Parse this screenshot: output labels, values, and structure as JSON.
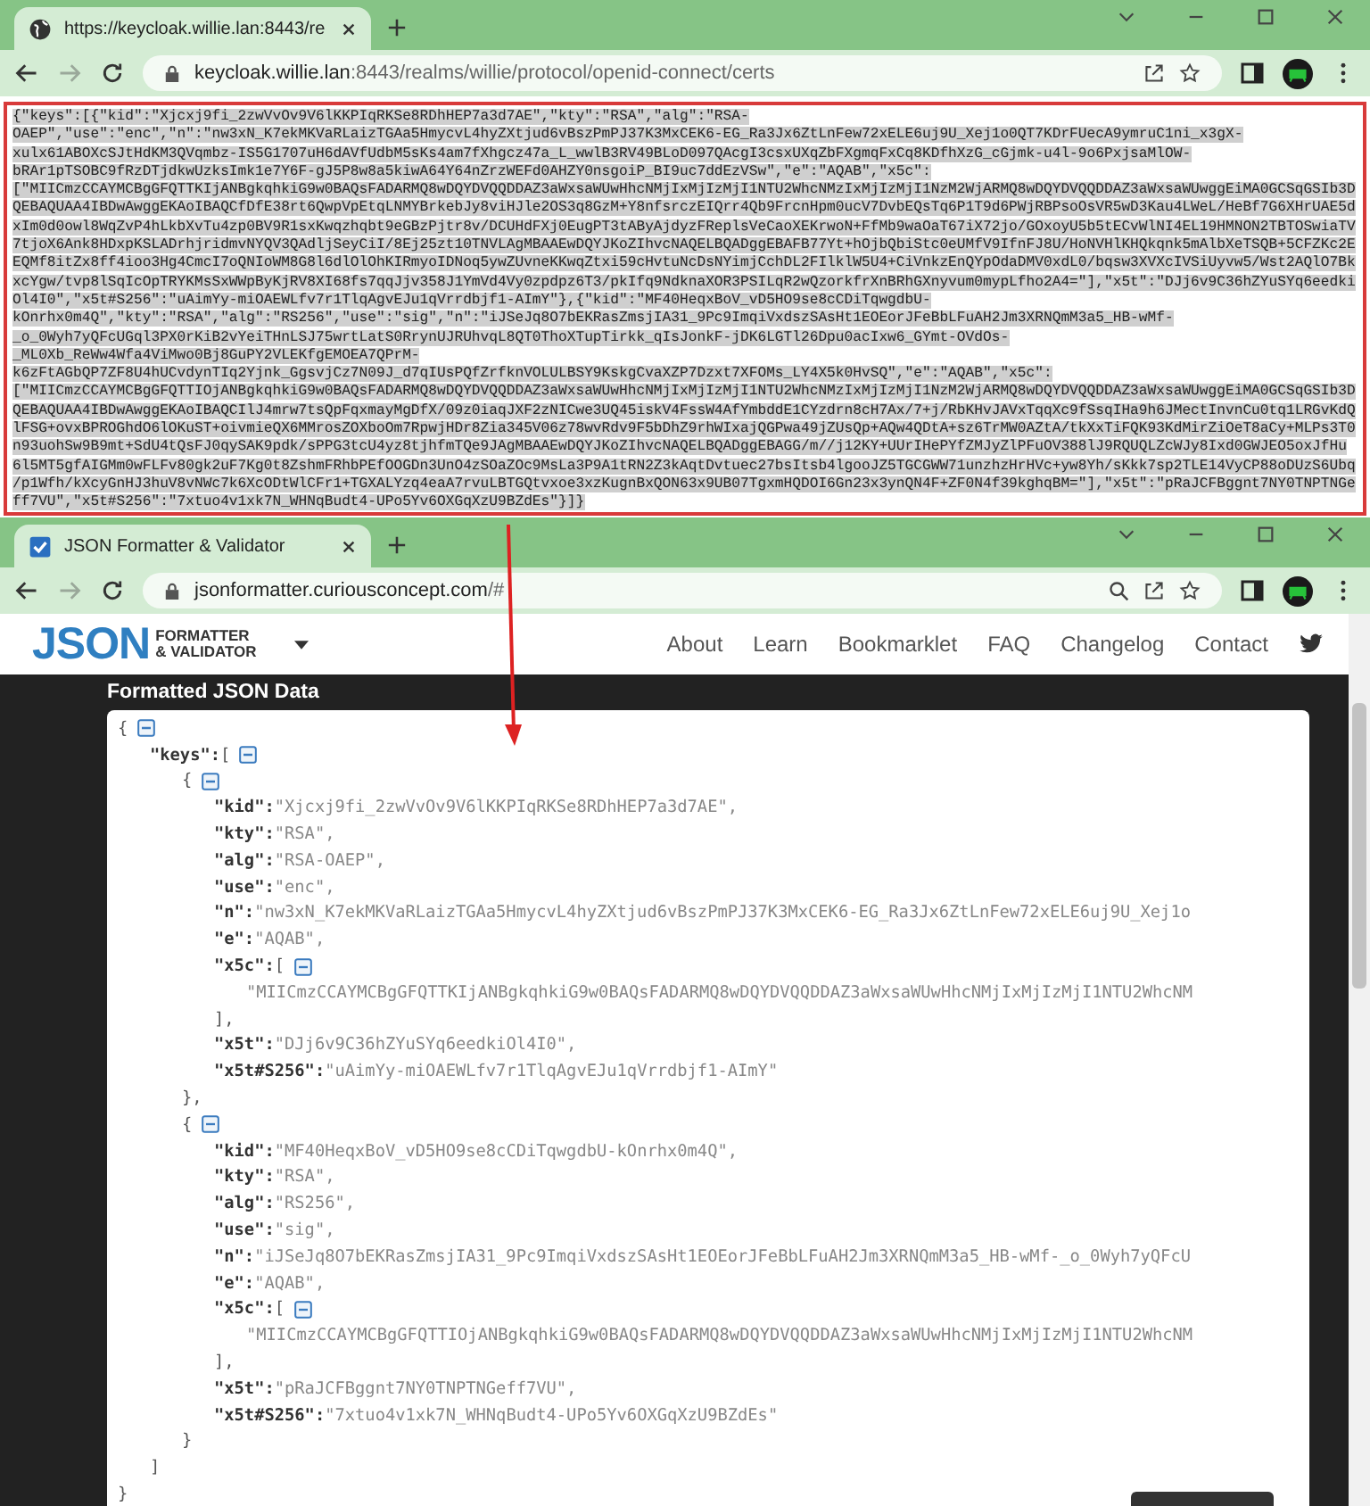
{
  "top_window": {
    "tab": {
      "kind": "globe",
      "title": "https://keycloak.willie.lan:8443/re"
    },
    "url": {
      "host": "keycloak.willie.lan",
      "path": ":8443/realms/willie/protocol/openid-connect/certs"
    },
    "forward_disabled": true,
    "zoom_icon": false,
    "raw_json_lines": [
      "{\"keys\":[{\"kid\":\"Xjcxj9fi_2zwVvOv9V6lKKPIqRKSe8RDhHEP7a3d7AE\",\"kty\":\"RSA\",\"alg\":\"RSA-",
      "OAEP\",\"use\":\"enc\",\"n\":\"nw3xN_K7ekMKVaRLaizTGAa5HmycvL4hyZXtjud6vBszPmPJ37K3MxCEK6-EG_Ra3Jx6ZtLnFew72xELE6uj9U_Xej1o0QT7KDrFUecA9ymruC1ni_x3gX-",
      "xulx61ABOXcSJtHdKM3QVqmbz-IS5G1707uH6dAVfUdbM5sKs4am7fXhgcz47a_L_wwlB3RV49BLoD097QAcgI3csxUXqZbFXgmqFxCq8KDfhXzG_cGjmk-u4l-9o6PxjsaMlOW-",
      "bRAr1pTSOBC9fRzDTjdkwUzksImk1e7Y6F-gJ5P8w8a5kiwA64Y64nZrzWEFd0AHZY0nsgoiP_BI9uc7ddEzVSw\",\"e\":\"AQAB\",\"x5c\":",
      "[\"MIICmzCCAYMCBgGFQTTKIjANBgkqhkiG9w0BAQsFADARMQ8wDQYDVQQDDAZ3aWxsaWUwHhcNMjIxMjIzMjI1NTU2WhcNMzIxMjIzMjI1NzM2WjARMQ8wDQYDVQQDDAZ3aWxsaWUwggEiMA0GCSqGSIb3D",
      "QEBAQUAA4IBDwAwggEKAoIBAQCfDfE38rt6QwpVpEtqLNMYBrkebJy8viHJle2OS3q8GzM+Y8nfsrczEIQrr4Qb9FrcnHpm0ucV7DvbEQsTq6P1T9d6PWjRBPsoOsVR5wD3Kau4LWeL/HeBf7G6XHrUAE5d",
      "xIm0d0owl8WqZvP4hLkbXvTu4zp0BV9R1sxKwqzhqbt9eGBzPjtr8v/DCUHdFXj0EugPT3tAByAjdyzFReplsVeCaoXEKrwoN+FfMb9waOaT67iX72jo/GOxoyU5b5tECvWlNI4EL19HMNON2TBTOSwiaTV",
      "7tjoX6Ank8HDxpKSLADrhjridmvNYQV3QAdljSeyCiI/8Ej25zt10TNVLAgMBAAEwDQYJKoZIhvcNAQELBQADggEBAFB77Yt+hOjbQbiStc0eUMfV9IfnFJ8U/HoNVHlKHQkqnk5mAlbXeTSQB+5CFZKc2E",
      "EQMf8itZx8ff4ioo3Hg4CmcI7oQNIoWM8G8l6dlOlOhKIRmyoIDNoq5ywZUvneKKwqZtxi59cHvtuNcDsNYimjCchDL2FIlklW5U4+CiVnkzEnQYpOdaDMV0xdL0/bqsw3XVXcIVSiUyvw5/Wst2AQlO7Bk",
      "xcYgw/tvp8lSqIcOpTRYKMsSxWWpByKjRV8XI68fs7qqJjv358J1YmVd4Vy0zpdpz6T3/pkIfq9NdknaXOR3PSILqR2wQzorkfrXnBRhGXnyvum0mypLfho2A4=\"],\"x5t\":\"DJj6v9C36hZYuSYq6eedki",
      "Ol4I0\",\"x5t#S256\":\"uAimYy-miOAEWLfv7r1TlqAgvEJu1qVrrdbjf1-AImY\"},{\"kid\":\"MF40HeqxBoV_vD5HO9se8cCDiTqwgdbU-",
      "kOnrhx0m4Q\",\"kty\":\"RSA\",\"alg\":\"RS256\",\"use\":\"sig\",\"n\":\"iJSeJq8O7bEKRasZmsjIA31_9Pc9ImqiVxdszSAsHt1EOEorJFeBbLFuAH2Jm3XRNQmM3a5_HB-wMf-",
      "_o_0Wyh7yQFcUGql3PX0rKiB2vYeiTHnLSJ75wrtLatS0RrynUJRUhvqL8QT0ThoXTupTirkk_qIsJonkF-jDK6LGTl26Dpu0acIxw6_GYmt-OVdOs-",
      "_ML0Xb_ReWw4Wfa4ViMwo0Bj8GuPY2VLEKfgEMOEA7QPrM-",
      "k6zFtAGbQP7ZF8U4hUCvdynTIq2Yjnk_GgsvjCz7N09J_d7qIUsPQfZrfknVOLULBSY9KskgCvaXZP7Dzxt7XFOMs_LY4X5k0HvSQ\",\"e\":\"AQAB\",\"x5c\":",
      "[\"MIICmzCCAYMCBgGFQTTIOjANBgkqhkiG9w0BAQsFADARMQ8wDQYDVQQDDAZ3aWxsaWUwHhcNMjIxMjIzMjI1NTU2WhcNMzIxMjIzMjI1NzM2WjARMQ8wDQYDVQQDDAZ3aWxsaWUwggEiMA0GCSqGSIb3D",
      "QEBAQUAA4IBDwAwggEKAoIBAQCIlJ4mrw7tsQpFqxmayMgDfX/09z0iaqJXF2zNICwe3UQ45iskV4FssW4AfYmbddE1CYzdrn8cH7Ax/7+j/RbKHvJAVxTqqXc9fSsqIHa9h6JMectInvnCu0tq1LRGvKdQ",
      "lFSG+ovxBPROGhdO6lOKuST+oivmieQX6MMrosZOXboOm7RpwjHDr8Zia345V06z78wvRdv9F5bDhZ9rhWIxajQGPwa49jZUsQp+AQw4QDtA+sz6TrMW0AZtA/tkXxTiFQK93KdMirZiOeT8aCy+MLPs3T0",
      "n93uohSw9B9mt+SdU4tQsFJ0qySAK9pdk/sPPG3tcU4yz8tjhfmTQe9JAgMBAAEwDQYJKoZIhvcNAQELBQADggEBAGG/m//j12KY+UUrIHePYfZMJyZlPFuOV388lJ9RQUQLZcWJy8Ixd0GWJEO5oxJfHu",
      "6l5MT5gfAIGMm0wFLFv80gk2uF7Kg0t8ZshmFRhbPEfOOGDn3UnO4zSOaZOc9MsLa3P9A1tRN2Z3kAqtDvtuec27bsItsb4lgooJZ5TGCGWW71unzhzHrHVc+yw8Yh/sKkk7sp2TLE14VyCP88oDUzS6Ubq",
      "/p1Wfh/kXcyGnHJ3huV8vNWc7k6XcODtWlCFr1+TGXALYzq4eaA7rvuLBTGQtvxoe3xzKugnBxQON63x9UB07TgxmHQDOI6Gn23x3ynQN4F+ZF0N4f39kghqBM=\"],\"x5t\":\"pRaJCFBggnt7NY0TNPTNGe",
      "ff7VU\",\"x5t#S256\":\"7xtuo4v1xk7N_WHNqBudt4-UPo5Yv6OXGqXzU9BZdEs\"}]}"
    ]
  },
  "bottom_window": {
    "tab": {
      "kind": "checkbox",
      "title": "JSON Formatter & Validator"
    },
    "url": {
      "host": "jsonformatter.curiousconcept.com",
      "path": "/#"
    },
    "forward_disabled": true,
    "zoom_icon": true,
    "site": {
      "logo": {
        "big": "JSON",
        "line_1": "FORMATTER",
        "line_2": "& VALIDATOR"
      },
      "nav": [
        "About",
        "Learn",
        "Bookmarklet",
        "FAQ",
        "Changelog",
        "Contact"
      ],
      "section_title": "Formatted JSON Data"
    },
    "formatted_json": {
      "open": "{",
      "expanded": true,
      "close": "}",
      "children": [
        {
          "key": "\"keys\":",
          "open": "[",
          "expanded": true,
          "close": "]",
          "children": [
            {
              "open": "{",
              "expanded": true,
              "close": "},",
              "children": [
                {
                  "key": "\"kid\":",
                  "value": "\"Xjcxj9fi_2zwVvOv9V6lKKPIqRKSe8RDhHEP7a3d7AE\","
                },
                {
                  "key": "\"kty\":",
                  "value": "\"RSA\","
                },
                {
                  "key": "\"alg\":",
                  "value": "\"RSA-OAEP\","
                },
                {
                  "key": "\"use\":",
                  "value": "\"enc\","
                },
                {
                  "key": "\"n\":",
                  "value": "\"nw3xN_K7ekMKVaRLaizTGAa5HmycvL4hyZXtjud6vBszPmPJ37K3MxCEK6-EG_Ra3Jx6ZtLnFew72xELE6uj9U_Xej1o"
                },
                {
                  "key": "\"e\":",
                  "value": "\"AQAB\","
                },
                {
                  "key": "\"x5c\":",
                  "open": "[",
                  "expanded": true,
                  "close": "],",
                  "children": [
                    {
                      "value": "\"MIICmzCCAYMCBgGFQTTKIjANBgkqhkiG9w0BAQsFADARMQ8wDQYDVQQDDAZ3aWxsaWUwHhcNMjIxMjIzMjI1NTU2WhcNM"
                    }
                  ]
                },
                {
                  "key": "\"x5t\":",
                  "value": "\"DJj6v9C36hZYuSYq6eedkiOl4I0\","
                },
                {
                  "key": "\"x5t#S256\":",
                  "value": "\"uAimYy-miOAEWLfv7r1TlqAgvEJu1qVrrdbjf1-AImY\""
                }
              ]
            },
            {
              "open": "{",
              "expanded": true,
              "close": "}",
              "children": [
                {
                  "key": "\"kid\":",
                  "value": "\"MF40HeqxBoV_vD5HO9se8cCDiTqwgdbU-kOnrhx0m4Q\","
                },
                {
                  "key": "\"kty\":",
                  "value": "\"RSA\","
                },
                {
                  "key": "\"alg\":",
                  "value": "\"RS256\","
                },
                {
                  "key": "\"use\":",
                  "value": "\"sig\","
                },
                {
                  "key": "\"n\":",
                  "value": "\"iJSeJq8O7bEKRasZmsjIA31_9Pc9ImqiVxdszSAsHt1EOEorJFeBbLFuAH2Jm3XRNQmM3a5_HB-wMf-_o_0Wyh7yQFcU"
                },
                {
                  "key": "\"e\":",
                  "value": "\"AQAB\","
                },
                {
                  "key": "\"x5c\":",
                  "open": "[",
                  "expanded": true,
                  "close": "],",
                  "children": [
                    {
                      "value": "\"MIICmzCCAYMCBgGFQTTIOjANBgkqhkiG9w0BAQsFADARMQ8wDQYDVQQDDAZ3aWxsaWUwHhcNMjIxMjIzMjI1NTU2WhcNM"
                    }
                  ]
                },
                {
                  "key": "\"x5t\":",
                  "value": "\"pRaJCFBggnt7NY0TNPTNGeff7VU\","
                },
                {
                  "key": "\"x5t#S256\":",
                  "value": "\"7xtuo4v1xk7N_WHNqBudt4-UPo5Yv6OXGqXzU9BZdEs\""
                }
              ]
            }
          ]
        }
      ]
    }
  }
}
